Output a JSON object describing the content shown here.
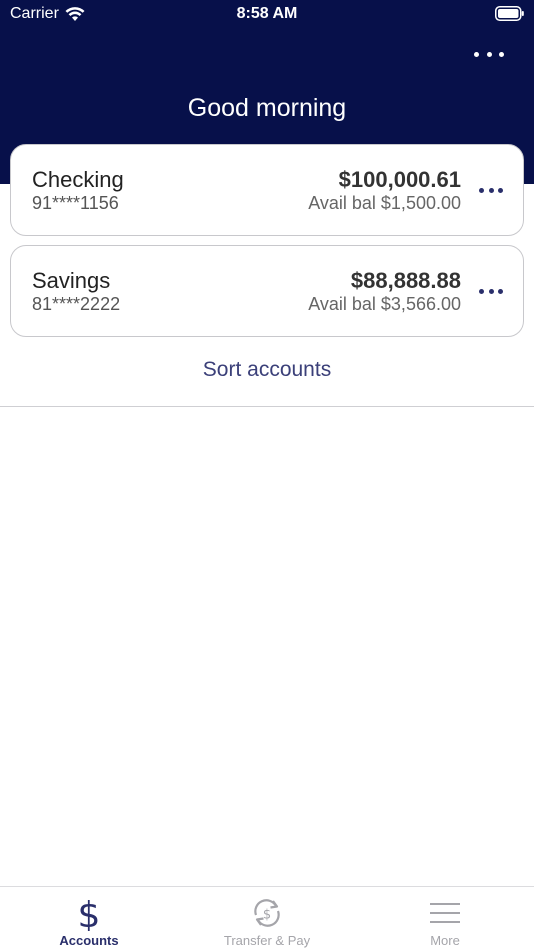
{
  "status_bar": {
    "carrier": "Carrier",
    "time": "8:58 AM"
  },
  "header": {
    "greeting": "Good morning",
    "more_icon": "ellipsis-icon"
  },
  "accounts": [
    {
      "name": "Checking",
      "number": "91****1156",
      "balance": "$100,000.61",
      "available": "Avail bal $1,500.00"
    },
    {
      "name": "Savings",
      "number": "81****2222",
      "balance": "$88,888.88",
      "available": "Avail bal $3,566.00"
    }
  ],
  "sort_label": "Sort accounts",
  "tabs": [
    {
      "label": "Accounts",
      "icon": "dollar-icon",
      "active": true
    },
    {
      "label": "Transfer & Pay",
      "icon": "transfer-dollar-icon",
      "active": false
    },
    {
      "label": "More",
      "icon": "hamburger-icon",
      "active": false
    }
  ],
  "colors": {
    "header_bg": "#07104a",
    "accent": "#2a2f6b",
    "inactive": "#a5a5aa"
  }
}
